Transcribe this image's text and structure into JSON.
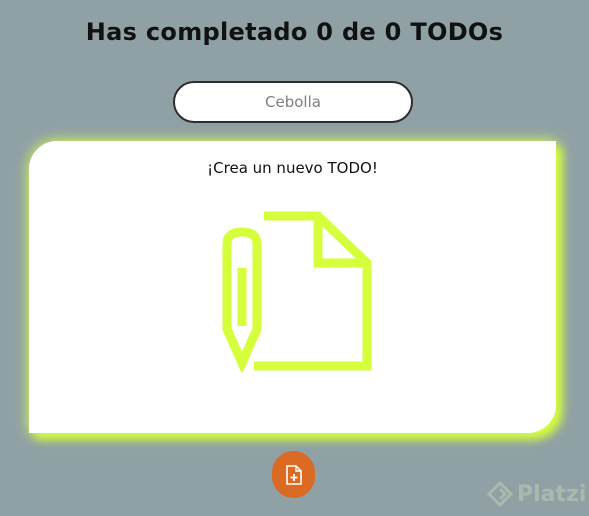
{
  "header": {
    "title": "Has completado 0 de 0 TODOs"
  },
  "search": {
    "placeholder": "Cebolla"
  },
  "empty_state": {
    "message": "¡Crea un nuevo TODO!",
    "icon": "document-edit-icon"
  },
  "add_button": {
    "icon": "add-file-icon",
    "color": "#db6a22"
  },
  "watermark": {
    "text": "Platzi"
  },
  "colors": {
    "background": "#8fa1a5",
    "accent": "#d4ff3a",
    "card": "#ffffff"
  }
}
